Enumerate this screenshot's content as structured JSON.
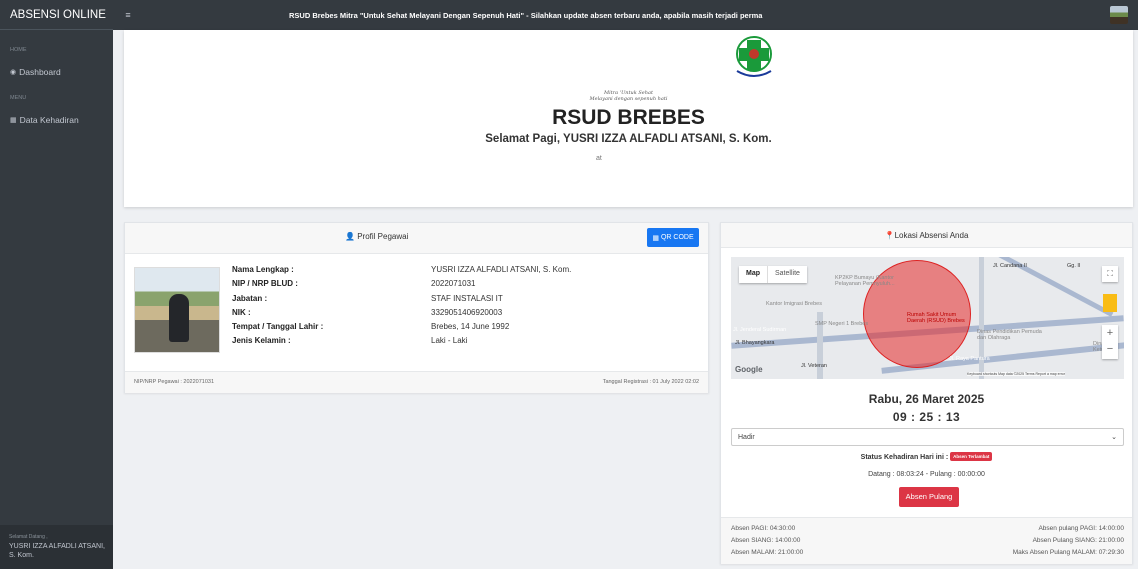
{
  "sidebar": {
    "brand": "ABSENSI ONLINE",
    "home_header": "HOME",
    "dashboard_label": "Dashboard",
    "menu_header": "MENU",
    "data_kehadiran_label": "Data Kehadiran",
    "footer_greeting": "Selamat Datang ,",
    "footer_name": "YUSRI IZZA ALFADLI ATSANI, S. Kom."
  },
  "topbar": {
    "menu_icon": "hamburger-icon",
    "marquee_text": "RSUD Brebes Mitra \"Untuk Sehat Melayani Dengan Sepenuh Hati\" - Silahkan update absen terbaru anda, apabila masih terjadi perma"
  },
  "hero": {
    "logo_text": "RSUD BREBES",
    "tagline_1": "Mitra 'Untuk Sehat",
    "tagline_2": "Melayani dengan sepenuh hati",
    "title": "RSUD BREBES",
    "greeting": "Selamat Pagi, YUSRI IZZA ALFADLI ATSANI, S. Kom.",
    "fragment": "at"
  },
  "profile": {
    "title": "Profil Pegawai",
    "qr_label": "QR CODE",
    "labels": {
      "nama": "Nama Lengkap :",
      "nip": "NIP / NRP BLUD :",
      "jabatan": "Jabatan :",
      "nik": "NIK :",
      "ttl": "Tempat / Tanggal Lahir :",
      "jk": "Jenis Kelamin :"
    },
    "values": {
      "nama": "YUSRI IZZA ALFADLI ATSANI, S. Kom.",
      "nip": "2022071031",
      "jabatan": "STAF INSTALASI IT",
      "nik": "3329051406920003",
      "ttl": "Brebes, 14 June 1992",
      "jk": "Laki - Laki"
    },
    "footer_left": "NIP/NRP Pegawai : 2022071031",
    "footer_right": "Tanggal Registrasi : 01 July 2022 02:02"
  },
  "location": {
    "title": "Lokasi Absensi Anda",
    "map": {
      "map_label": "Map",
      "satellite_label": "Satellite",
      "labels": {
        "kp2kp": "KP2KP Bumayu (Kantor Pelayanan Pemnyuluh...",
        "imigrasi": "Kantor Imigrasi Brebes",
        "smp": "SMP Negeri 1 Brebes",
        "rsud": "Rumah Sakit Umum Daerah (RSUD) Brebes",
        "dinas": "Dinas Pendidikan Pemuda dan Olahraga",
        "dina2": "Dina Ketu",
        "jl_candana": "Jl. Candana II",
        "jl_sudirman": "Jl. Jenderal Sudirman",
        "jl_bayangkara": "Jl. Bhayangkara",
        "jl_pantura": "Jl. Raya Pantura",
        "jl_veteran": "Jl. Veteran",
        "jl_gg": "Gg. II",
        "google": "Google",
        "attribution": "Keyboard shortcuts   Map data ©2025   Terms   Report a map error"
      }
    },
    "date": "Rabu, 26 Maret 2025",
    "time": "09 : 25 : 13",
    "select_value": "Hadir",
    "status_label": "Status Kehadiran Hari ini :",
    "status_badge": "Absen Terlambat",
    "times": "Datang : 08:03:24 - Pulang : 00:00:00",
    "button": "Absen Pulang",
    "footer": {
      "pagi": "Absen PAGI: 04:30:00",
      "siang": "Absen SIANG: 14:00:00",
      "malam": "Absen MALAM: 21:00:00",
      "pulang_pagi": "Absen pulang PAGI: 14:00:00",
      "pulang_siang": "Absen Pulang SIANG: 21:00:00",
      "pulang_malam": "Maks Absen Pulang MALAM: 07:29:30"
    }
  },
  "colors": {
    "sidebar": "#343a40",
    "primary": "#1877f2",
    "danger": "#dc3545",
    "logo_green": "#1a9a3a"
  }
}
